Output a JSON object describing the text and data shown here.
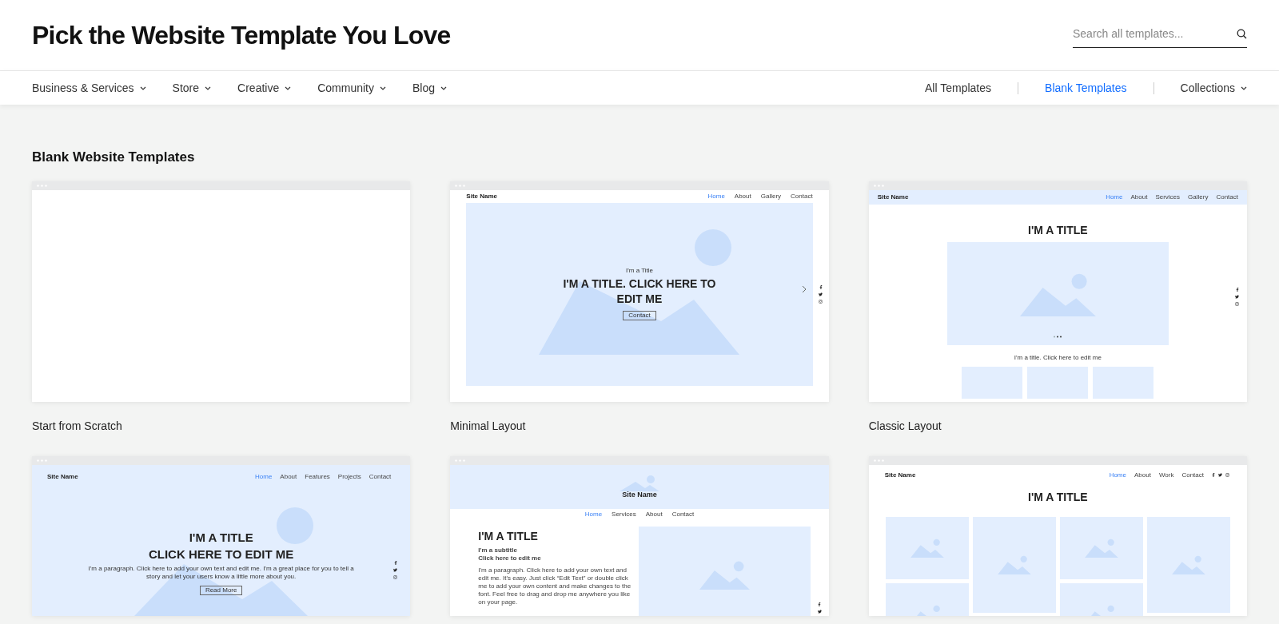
{
  "header": {
    "title": "Pick the Website Template You Love",
    "search": {
      "placeholder": "Search all templates..."
    }
  },
  "nav": {
    "categories": [
      {
        "label": "Business & Services"
      },
      {
        "label": "Store"
      },
      {
        "label": "Creative"
      },
      {
        "label": "Community"
      },
      {
        "label": "Blog"
      }
    ],
    "links": [
      {
        "label": "All Templates",
        "kind": "link",
        "selected": false
      },
      {
        "label": "Blank Templates",
        "kind": "link",
        "selected": true
      },
      {
        "label": "Collections",
        "kind": "dropdown",
        "selected": false
      }
    ]
  },
  "section": {
    "title": "Blank Website Templates",
    "templates": [
      {
        "name": "Start from Scratch",
        "preview": {
          "kind": "blank"
        }
      },
      {
        "name": "Minimal Layout",
        "preview": {
          "kind": "hero",
          "site_name": "Site Name",
          "menu": [
            {
              "label": "Home",
              "selected": true
            },
            {
              "label": "About",
              "selected": false
            },
            {
              "label": "Gallery",
              "selected": false
            },
            {
              "label": "Contact",
              "selected": false
            }
          ],
          "eyebrow": "I'm a Title",
          "title": "I'M A TITLE. CLICK HERE TO EDIT ME",
          "button": "Contact"
        }
      },
      {
        "name": "Classic Layout",
        "preview": {
          "kind": "classic",
          "site_name": "Site Name",
          "menu": [
            {
              "label": "Home",
              "selected": true
            },
            {
              "label": "About",
              "selected": false
            },
            {
              "label": "Services",
              "selected": false
            },
            {
              "label": "Gallery",
              "selected": false
            },
            {
              "label": "Contact",
              "selected": false
            }
          ],
          "title": "I'M A TITLE",
          "subtitle": "I'm a title. Click here to edit me"
        }
      },
      {
        "preview": {
          "kind": "hero_paragraph",
          "site_name": "Site Name",
          "menu": [
            {
              "label": "Home",
              "selected": true
            },
            {
              "label": "About",
              "selected": false
            },
            {
              "label": "Features",
              "selected": false
            },
            {
              "label": "Projects",
              "selected": false
            },
            {
              "label": "Contact",
              "selected": false
            }
          ],
          "title_lines": [
            "I'M A TITLE",
            "CLICK HERE TO EDIT ME"
          ],
          "paragraph": "I'm a paragraph. Click here to add your own text and edit me. I'm a great place for you to tell a story and let your users know a little more about you.",
          "button": "Read More"
        }
      },
      {
        "preview": {
          "kind": "banner",
          "site_name": "Site Name",
          "menu": [
            {
              "label": "Home",
              "selected": true
            },
            {
              "label": "Services",
              "selected": false
            },
            {
              "label": "About",
              "selected": false
            },
            {
              "label": "Contact",
              "selected": false
            }
          ],
          "title": "I'M A TITLE",
          "subtitle_lines": [
            "I'm a subtitle",
            "Click here to edit me"
          ],
          "paragraph": "I'm a paragraph. Click here to add your own text and edit me. It's easy. Just click “Edit Text” or double click me to add your own content and make changes to the font. Feel free to drag and drop me anywhere you like on your page."
        }
      },
      {
        "preview": {
          "kind": "grid",
          "site_name": "Site Name",
          "menu": [
            {
              "label": "Home",
              "selected": true
            },
            {
              "label": "About",
              "selected": false
            },
            {
              "label": "Work",
              "selected": false
            },
            {
              "label": "Contact",
              "selected": false
            }
          ],
          "title": "I'M A TITLE"
        }
      }
    ]
  }
}
